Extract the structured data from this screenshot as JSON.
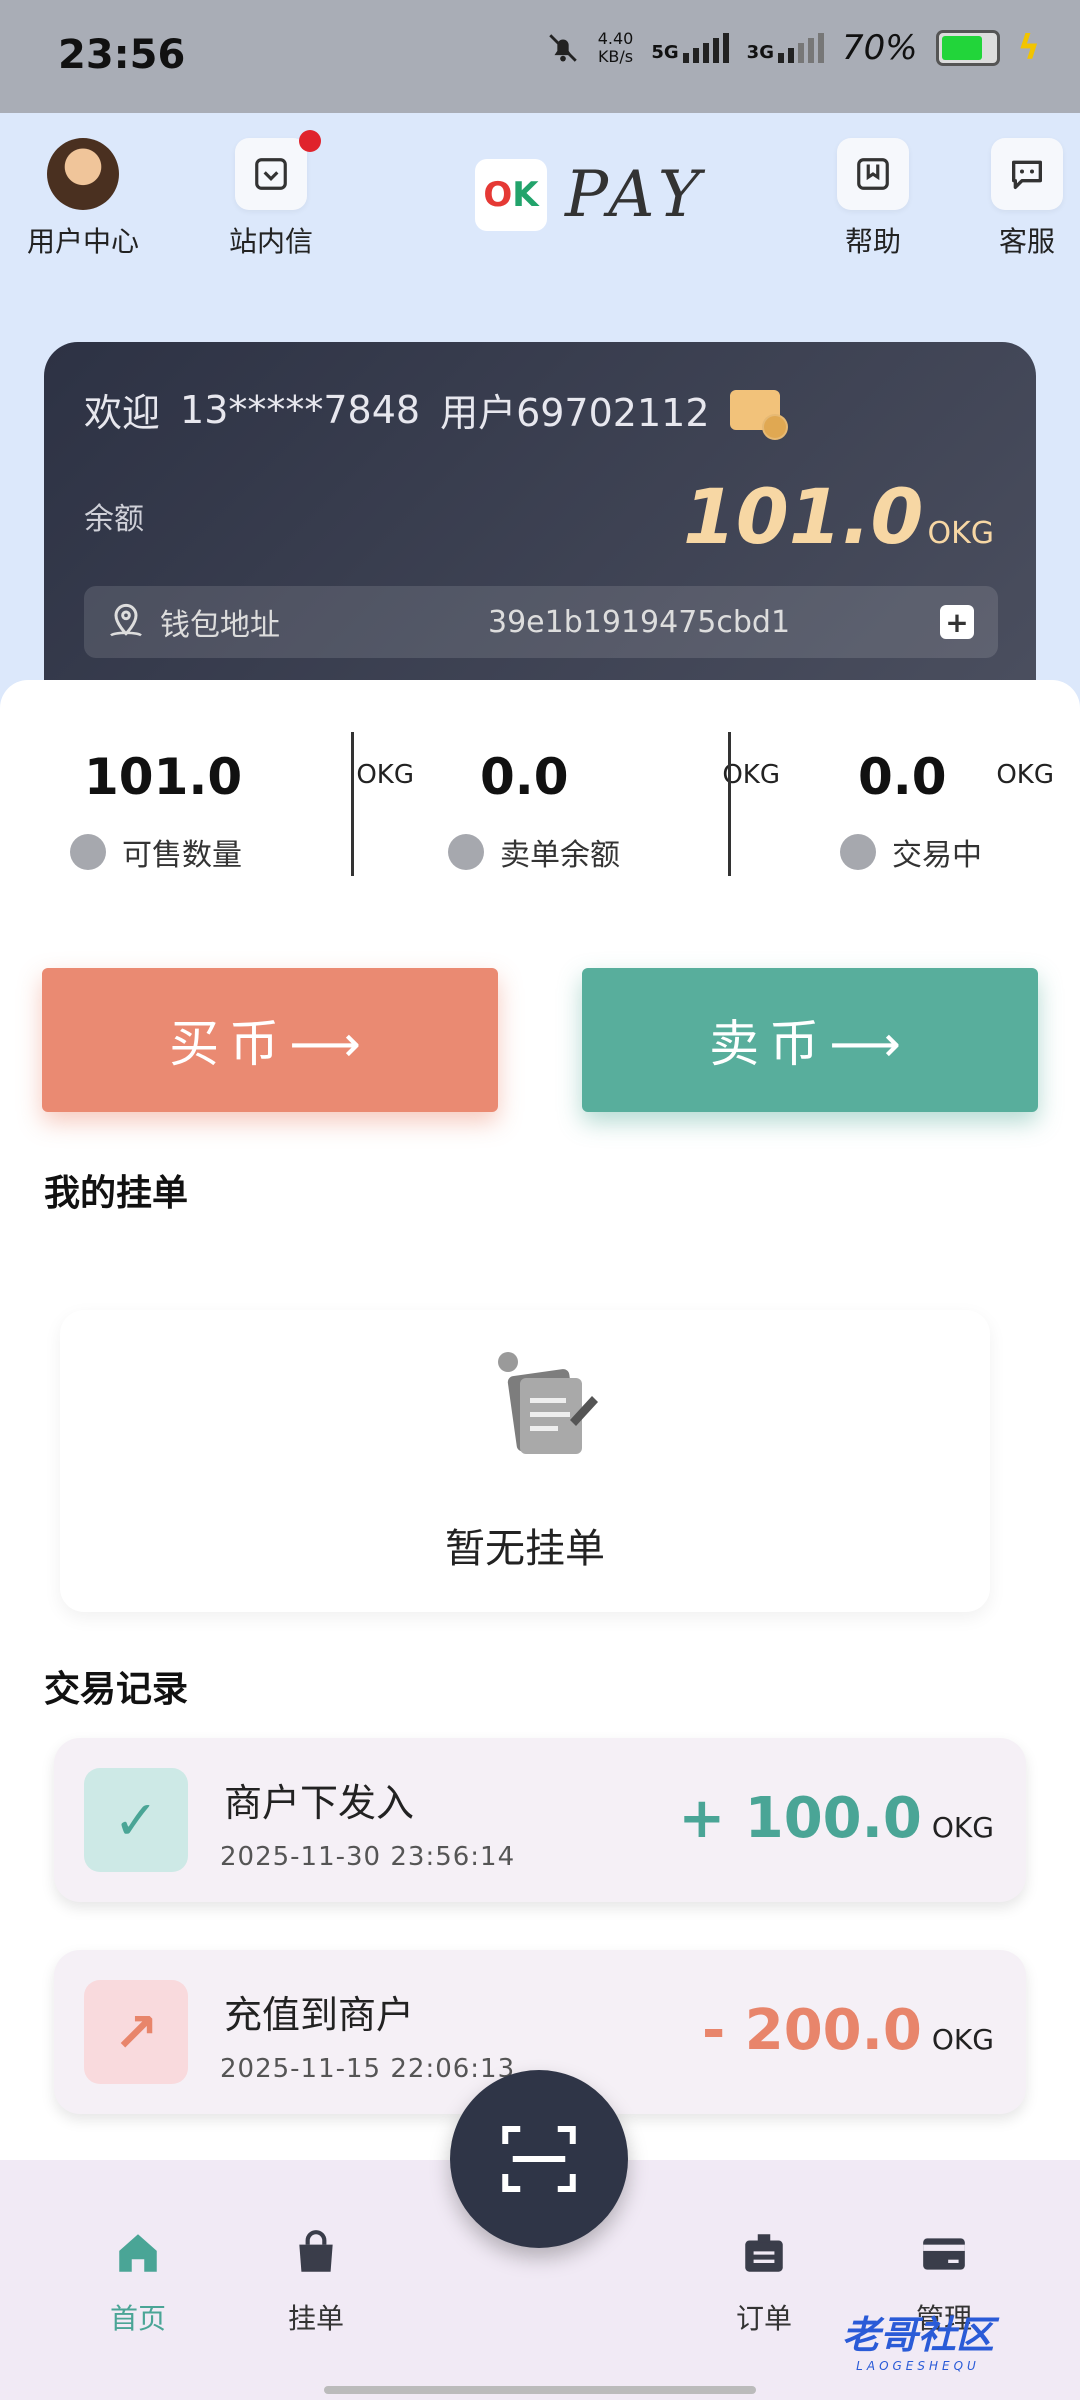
{
  "status_bar": {
    "time": "23:56",
    "net_speed": "4.40",
    "net_unit": "KB/s",
    "sim1": "5G",
    "sim2": "3G",
    "battery": "70%"
  },
  "header": {
    "user_center": "用户中心",
    "messages": "站内信",
    "brand": "PAY",
    "brand_mark": "OK",
    "help": "帮助",
    "service": "客服"
  },
  "card": {
    "welcome": "欢迎",
    "phone": "13*****7848",
    "user": "用户69702112",
    "balance_label": "余额",
    "balance": "101.0",
    "unit": "OKG",
    "wallet_label": "钱包地址",
    "wallet_address": "39e1b1919475cbd1"
  },
  "stats": [
    {
      "value": "101.0",
      "unit": "OKG",
      "label": "可售数量"
    },
    {
      "value": "0.0",
      "unit": "OKG",
      "label": "卖单余额"
    },
    {
      "value": "0.0",
      "unit": "OKG",
      "label": "交易中"
    }
  ],
  "actions": {
    "buy": "买币⟶",
    "sell": "卖币⟶"
  },
  "my_orders": {
    "title": "我的挂单",
    "empty": "暂无挂单"
  },
  "records": {
    "title": "交易记录",
    "items": [
      {
        "title": "商户下发入",
        "date": "2025-11-30 23:56:14",
        "amount": "+ 100.0",
        "unit": "OKG",
        "color": "#4aa596",
        "icon": "check-icon"
      },
      {
        "title": "充值到商户",
        "date": "2025-11-15 22:06:13",
        "amount": "- 200.0",
        "unit": "OKG",
        "color": "#e8856b",
        "icon": "arrow-up-right-icon"
      }
    ]
  },
  "nav": {
    "home": "首页",
    "orders_listing": "挂单",
    "orders": "订单",
    "manage": "管理"
  },
  "watermark": {
    "text": "老哥社区",
    "sub": "LAOGESHEQU"
  }
}
